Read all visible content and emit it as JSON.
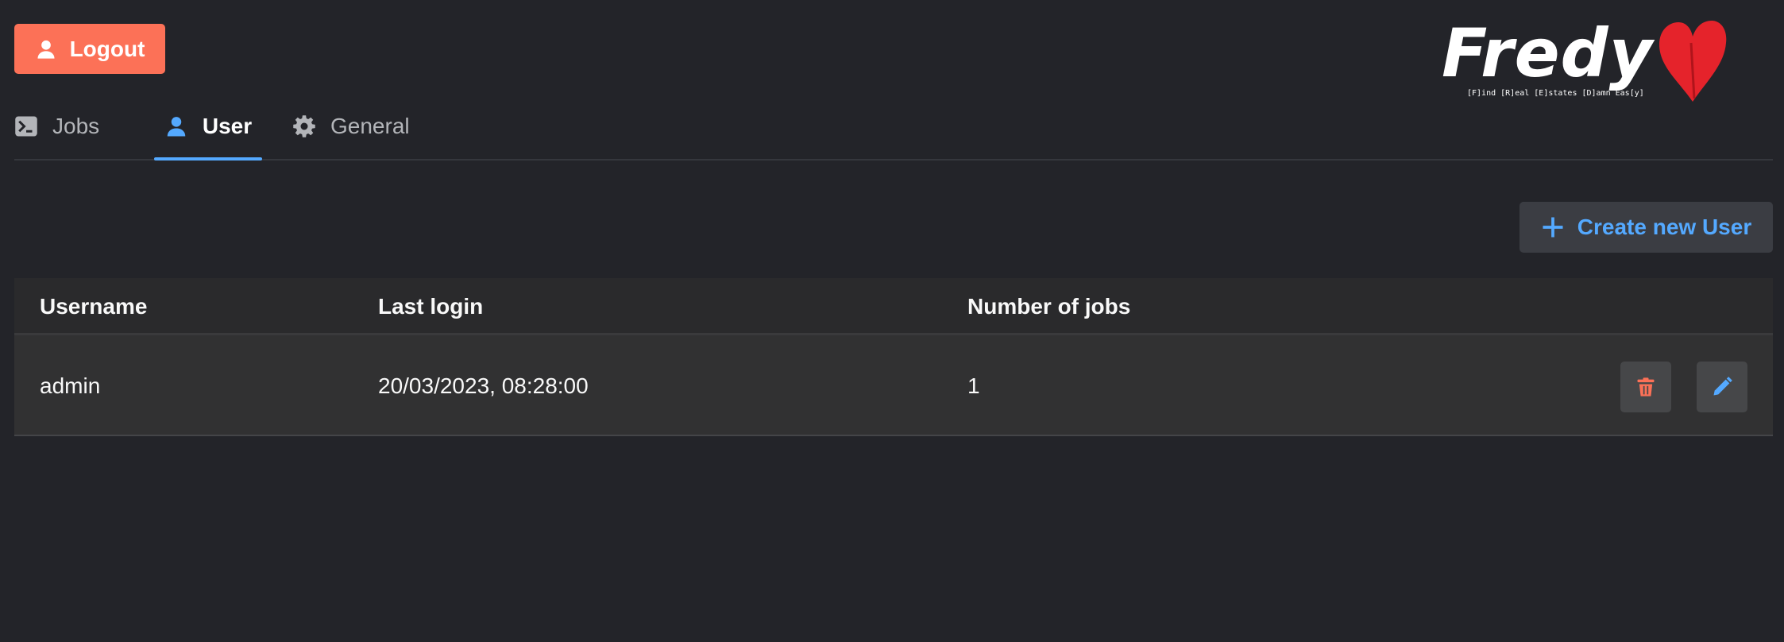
{
  "header": {
    "logout_label": "Logout",
    "logo": {
      "wordmark": "Fredy",
      "tagline": "[F]ind [R]eal [E]states [D]amn Eas[y]"
    }
  },
  "tabs": [
    {
      "label": "Jobs",
      "icon": "terminal-icon",
      "active": false
    },
    {
      "label": "User",
      "icon": "user-icon",
      "active": true
    },
    {
      "label": "General",
      "icon": "gear-icon",
      "active": false
    }
  ],
  "toolbar": {
    "create_label": "Create new User"
  },
  "table": {
    "headers": [
      "Username",
      "Last login",
      "Number of jobs"
    ],
    "rows": [
      {
        "username": "admin",
        "last_login": "20/03/2023, 08:28:00",
        "jobs": "1"
      }
    ]
  },
  "colors": {
    "background": "#232429",
    "logout": "#fc7157",
    "accent": "#54a9ff",
    "delete": "#fc7157",
    "heart": "#e5232b"
  }
}
